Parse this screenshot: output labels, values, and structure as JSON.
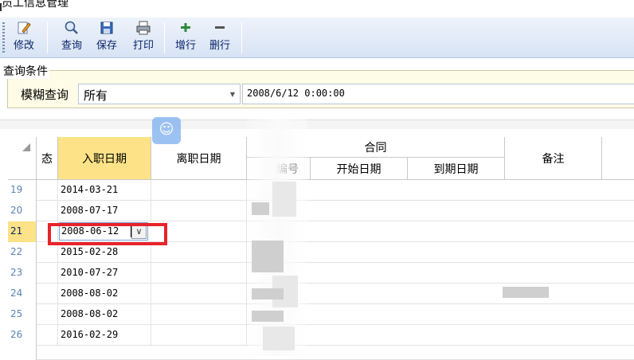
{
  "window": {
    "title": "员工信息管理"
  },
  "toolbar": {
    "buttons": [
      {
        "label": "修改",
        "icon": "edit-icon"
      },
      {
        "label": "查询",
        "icon": "search-icon"
      },
      {
        "label": "保存",
        "icon": "save-icon"
      },
      {
        "label": "打印",
        "icon": "print-icon"
      },
      {
        "label": "增行",
        "icon": "add-row-icon"
      },
      {
        "label": "删行",
        "icon": "delete-row-icon"
      }
    ]
  },
  "query": {
    "legend": "查询条件",
    "fuzzy_label": "模糊查询",
    "fuzzy_value": "所有",
    "date_value": "2008/6/12 0:00:00"
  },
  "grid": {
    "headers": {
      "status": "态",
      "hire_date": "入职日期",
      "leave_date": "离职日期",
      "contract_group": "合同",
      "contract_no": "编号",
      "start_date": "开始日期",
      "end_date": "到期日期",
      "remark": "备注"
    },
    "rows": [
      {
        "n": "19",
        "hire": "2014-03-21"
      },
      {
        "n": "20",
        "hire": "2008-07-17"
      },
      {
        "n": "21",
        "hire": "2008-06-12"
      },
      {
        "n": "22",
        "hire": "2015-02-28"
      },
      {
        "n": "23",
        "hire": "2010-07-27"
      },
      {
        "n": "24",
        "hire": "2008-08-02"
      },
      {
        "n": "25",
        "hire": "2008-08-02"
      },
      {
        "n": "26",
        "hire": "2016-02-29"
      }
    ],
    "current_row": "21"
  },
  "colors": {
    "highlight": "#fde287",
    "annotation": "#e8232b",
    "row_number": "#5b82b5"
  }
}
